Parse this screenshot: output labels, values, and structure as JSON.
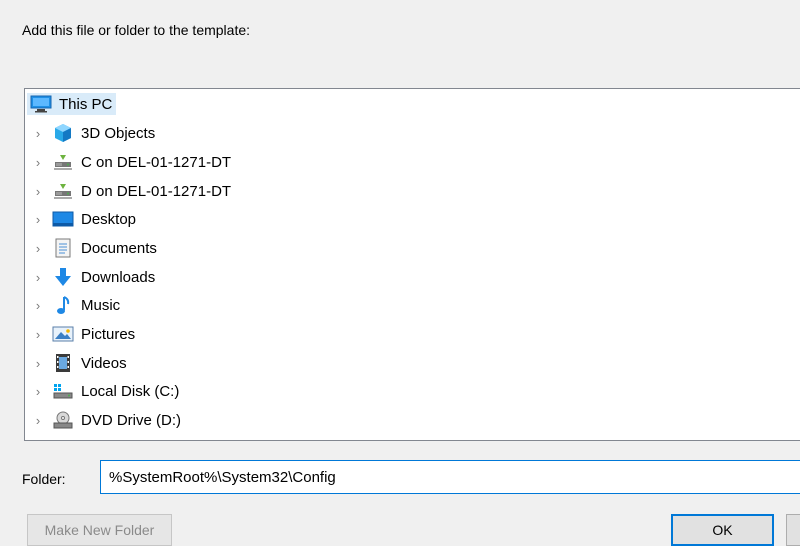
{
  "dialog": {
    "instruction": "Add this file or folder to the template:"
  },
  "tree": {
    "root": {
      "label": "This PC",
      "icon": "computer-icon"
    },
    "items": [
      {
        "label": "3D Objects",
        "icon": "3d-objects-icon"
      },
      {
        "label": "C on DEL-01-1271-DT",
        "icon": "network-drive-icon"
      },
      {
        "label": "D on DEL-01-1271-DT",
        "icon": "network-drive-icon"
      },
      {
        "label": "Desktop",
        "icon": "desktop-icon"
      },
      {
        "label": "Documents",
        "icon": "documents-icon"
      },
      {
        "label": "Downloads",
        "icon": "downloads-icon"
      },
      {
        "label": "Music",
        "icon": "music-icon"
      },
      {
        "label": "Pictures",
        "icon": "pictures-icon"
      },
      {
        "label": "Videos",
        "icon": "videos-icon"
      },
      {
        "label": "Local Disk (C:)",
        "icon": "local-disk-icon"
      },
      {
        "label": "DVD Drive (D:)",
        "icon": "dvd-drive-icon"
      }
    ]
  },
  "folder": {
    "label": "Folder:",
    "value": "%SystemRoot%\\System32\\Config"
  },
  "buttons": {
    "make_new_folder": "Make New Folder",
    "ok": "OK"
  },
  "colors": {
    "selection": "#d9ebf9",
    "accent": "#0078d7"
  }
}
